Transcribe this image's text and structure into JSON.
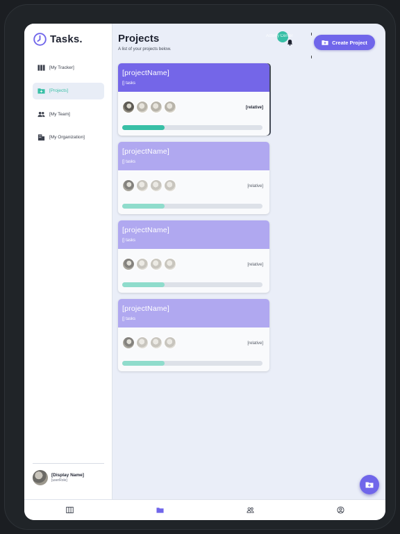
{
  "app": {
    "name": "Tasks."
  },
  "sidebar": {
    "items": [
      {
        "label": "[My Tracker]",
        "icon": "columns-icon",
        "active": false
      },
      {
        "label": "[Projects]",
        "icon": "folder-icon",
        "active": true
      },
      {
        "label": "[My Team]",
        "icon": "people-icon",
        "active": false
      },
      {
        "label": "[My Organization]",
        "icon": "building-icon",
        "active": false
      }
    ],
    "user": {
      "display_name": "[Display Name]",
      "role": "[userRole]"
    }
  },
  "header": {
    "title": "Projects",
    "subtitle": "A list of your projects below.",
    "activity_label": "Activity Center",
    "create_button_label": "Create Project"
  },
  "projects": [
    {
      "name": "[projectName]",
      "tasks": "[] tasks",
      "relative": "[relative]",
      "progress": 0.3
    },
    {
      "name": "[projectName]",
      "tasks": "[] tasks",
      "relative": "[relative]",
      "progress": 0.3
    },
    {
      "name": "[projectName]",
      "tasks": "[] tasks",
      "relative": "[relative]",
      "progress": 0.3
    },
    {
      "name": "[projectName]",
      "tasks": "[] tasks",
      "relative": "[relative]",
      "progress": 0.3
    }
  ],
  "tabs": [
    {
      "icon": "columns-icon"
    },
    {
      "icon": "folder-icon",
      "active": true
    },
    {
      "icon": "people-icon"
    },
    {
      "icon": "account-circle-icon"
    }
  ],
  "colors": {
    "accent": "#7066ea",
    "teal": "#38bfa6",
    "card_header_active": "#7466e8",
    "card_header": "#b0a8f0"
  }
}
